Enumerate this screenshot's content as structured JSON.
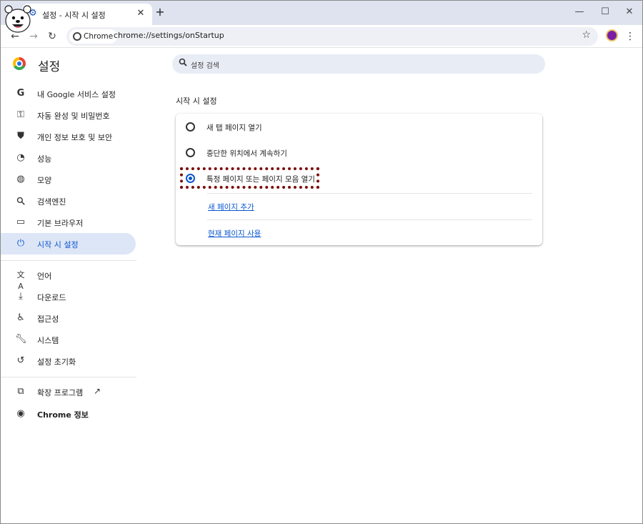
{
  "tab": {
    "title": "설정 - 시작 시 설정",
    "close_glyph": "✕",
    "new_tab_glyph": "+"
  },
  "window_controls": {
    "minimize": "—",
    "maximize": "☐",
    "close": "✕"
  },
  "toolbar": {
    "back": "←",
    "forward": "→",
    "reload": "↻",
    "chip_label": "Chrome",
    "url": "chrome://settings/onStartup",
    "bookmark": "☆",
    "menu": "⋮"
  },
  "header": {
    "title": "설정"
  },
  "search": {
    "placeholder": "설정 검색"
  },
  "sidebar": {
    "items": [
      {
        "label": "내 Google 서비스 설정",
        "icon": "google-icon"
      },
      {
        "label": "자동 완성 및 비밀번호",
        "icon": "key-icon"
      },
      {
        "label": "개인 정보 보호 및 보안",
        "icon": "shield-icon"
      },
      {
        "label": "성능",
        "icon": "speedometer-icon"
      },
      {
        "label": "모양",
        "icon": "palette-icon"
      },
      {
        "label": "검색엔진",
        "icon": "search-icon"
      },
      {
        "label": "기본 브라우저",
        "icon": "browser-window-icon"
      },
      {
        "label": "시작 시 설정",
        "icon": "power-icon",
        "active": true
      },
      {
        "label": "언어",
        "icon": "translate-icon"
      },
      {
        "label": "다운로드",
        "icon": "download-icon"
      },
      {
        "label": "접근성",
        "icon": "accessibility-icon"
      },
      {
        "label": "시스템",
        "icon": "wrench-icon"
      },
      {
        "label": "설정 초기화",
        "icon": "reset-icon"
      },
      {
        "label": "확장 프로그램",
        "icon": "puzzle-icon"
      },
      {
        "label": "Chrome 정보",
        "icon": "chrome-icon"
      }
    ]
  },
  "main": {
    "section_title": "시작 시 설정",
    "options": [
      {
        "label": "새 탭 페이지 열기",
        "checked": false
      },
      {
        "label": "중단한 위치에서 계속하기",
        "checked": false
      },
      {
        "label": "특정 페이지 또는 페이지 모음 열기",
        "checked": true
      }
    ],
    "links": {
      "add_page": "새 페이지 추가",
      "use_current": "현재 페이지 사용"
    }
  },
  "colors": {
    "accent": "#0b57d0",
    "highlight_border": "#7d0a0a",
    "active_nav_bg": "#dde6f6"
  }
}
